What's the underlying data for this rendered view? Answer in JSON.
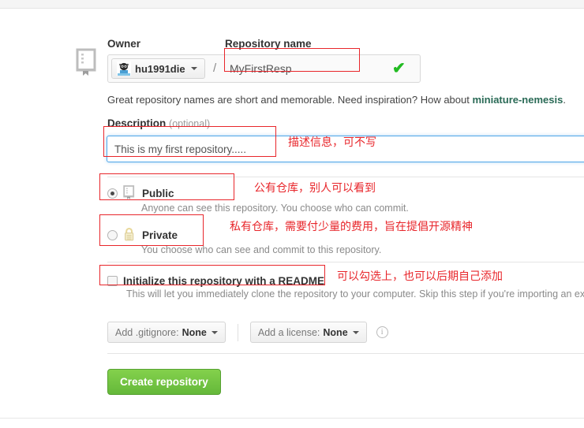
{
  "form": {
    "owner_label": "Owner",
    "repo_name_label": "Repository name",
    "owner_value": "hu1991die",
    "slash": "/",
    "repo_name_value": "MyFirstResp",
    "valid_check_icon": "✔",
    "helper_text_prefix": "Great repository names are short and memorable. Need inspiration? How about ",
    "helper_link": "miniature-nemesis",
    "helper_text_suffix": ".",
    "description_label": "Description",
    "description_optional": "(optional)",
    "description_value": "This is my first repository.....",
    "description_placeholder": "",
    "visibility": [
      {
        "id": "public",
        "title": "Public",
        "subtitle": "Anyone can see this repository. You choose who can commit.",
        "selected": true,
        "icon": "repo-book-icon"
      },
      {
        "id": "private",
        "title": "Private",
        "subtitle": "You choose who can see and commit to this repository.",
        "selected": false,
        "icon": "lock-icon"
      }
    ],
    "readme": {
      "title": "Initialize this repository with a README",
      "subtitle": "This will let you immediately clone the repository to your computer. Skip this step if you're importing an existing",
      "checked": false
    },
    "gitignore": {
      "prefix": "Add .gitignore: ",
      "value": "None"
    },
    "license": {
      "prefix": "Add a license: ",
      "value": "None"
    },
    "info_icon": "i",
    "submit_label": "Create repository"
  },
  "annotations": {
    "description": "描述信息，可不写",
    "public": "公有仓库，别人可以看到",
    "private": "私有仓库，需要付少量的费用，旨在提倡开源精神",
    "readme": "可以勾选上，也可以后期自己添加"
  },
  "colors": {
    "annotation_red": "#e8262b",
    "submit_green": "#6cc644",
    "valid_green": "#22bb22",
    "link_green": "#2a6a56",
    "focus_blue": "#51a7e8"
  }
}
